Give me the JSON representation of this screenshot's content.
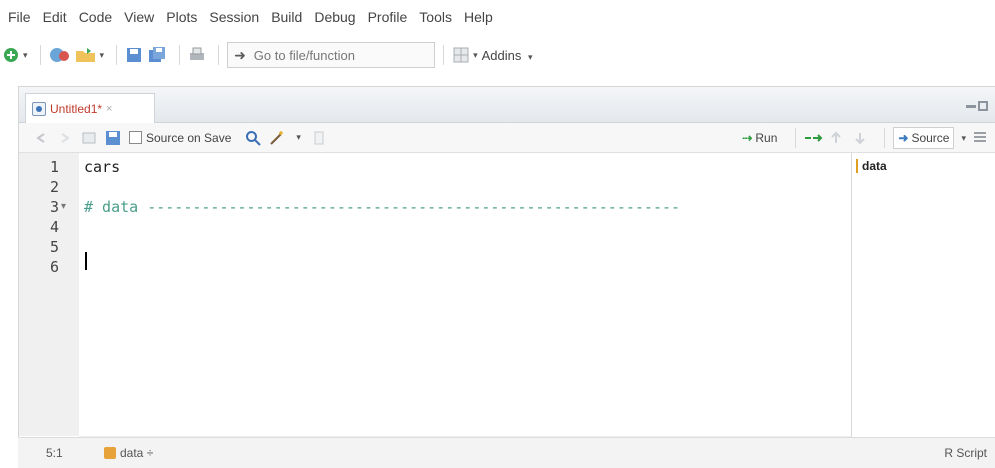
{
  "menu": [
    "File",
    "Edit",
    "Code",
    "View",
    "Plots",
    "Session",
    "Build",
    "Debug",
    "Profile",
    "Tools",
    "Help"
  ],
  "toolbar": {
    "goto_placeholder": "Go to file/function",
    "addins_label": "Addins"
  },
  "editor": {
    "tab_title": "Untitled1*",
    "tab_close": "×",
    "source_on_save_label": "Source on Save",
    "run_label": "Run",
    "source_label": "Source",
    "lines": [
      {
        "number": "1",
        "text": "cars",
        "kind": "plain"
      },
      {
        "number": "2",
        "text": "",
        "kind": "plain"
      },
      {
        "number": "3",
        "text": "# data -----------------------------------------------------------",
        "kind": "comment",
        "fold": "▾"
      },
      {
        "number": "4",
        "text": "",
        "kind": "plain"
      },
      {
        "number": "5",
        "text": "",
        "kind": "plain"
      },
      {
        "number": "6",
        "text": "",
        "kind": "plain"
      }
    ],
    "outline": [
      "data"
    ]
  },
  "status": {
    "position": "5:1",
    "section": "data ÷",
    "file_type": "R Script"
  },
  "colors": {
    "comment": "#4a9e8a",
    "tab_title": "#c0392b",
    "run_arrow": "#2e9a3e",
    "section_icon": "#e8a23a"
  }
}
